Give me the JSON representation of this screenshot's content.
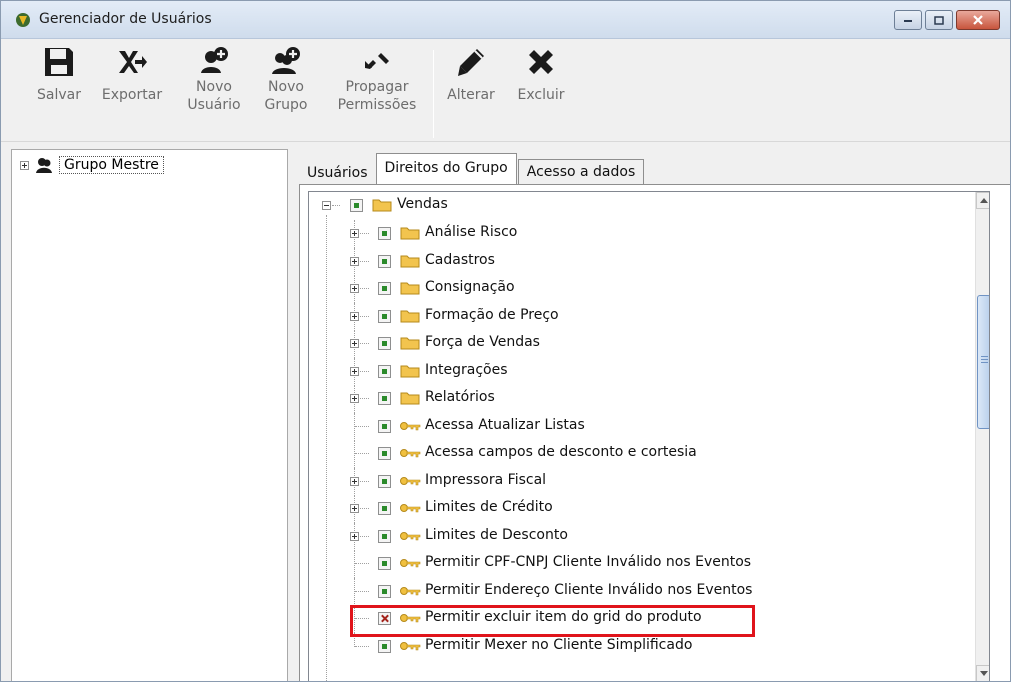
{
  "window": {
    "title": "Gerenciador de Usuários"
  },
  "toolbar": {
    "buttons": [
      {
        "name": "salvar",
        "label": "Salvar",
        "icon": "floppy-disk-icon"
      },
      {
        "name": "exportar",
        "label": "Exportar",
        "icon": "export-icon"
      },
      {
        "name": "novo-usuario",
        "label1": "Novo",
        "label2": "Usuário",
        "icon": "add-user-icon"
      },
      {
        "name": "novo-grupo",
        "label1": "Novo",
        "label2": "Grupo",
        "icon": "add-group-icon"
      },
      {
        "name": "propagar-permissoes",
        "label1": "Propagar",
        "label2": "Permissões",
        "icon": "propagate-icon"
      },
      {
        "name": "alterar",
        "label": "Alterar",
        "icon": "pencil-icon"
      },
      {
        "name": "excluir",
        "label": "Excluir",
        "icon": "delete-x-icon"
      }
    ]
  },
  "left_tree": {
    "root_label": "Grupo Mestre"
  },
  "tabs": [
    {
      "label": "Usuários",
      "active": false
    },
    {
      "label": "Direitos do Grupo",
      "active": true
    },
    {
      "label": "Acesso a dados",
      "active": false
    }
  ],
  "rights_tree": {
    "root": {
      "label": "Vendas",
      "checked": true,
      "expanded": true
    },
    "items": [
      {
        "label": "Análise Risco",
        "type": "folder",
        "checked": true,
        "expandable": true
      },
      {
        "label": "Cadastros",
        "type": "folder",
        "checked": true,
        "expandable": true
      },
      {
        "label": "Consignação",
        "type": "folder",
        "checked": true,
        "expandable": true
      },
      {
        "label": "Formação de Preço",
        "type": "folder",
        "checked": true,
        "expandable": true
      },
      {
        "label": "Força de Vendas",
        "type": "folder",
        "checked": true,
        "expandable": true
      },
      {
        "label": "Integrações",
        "type": "folder",
        "checked": true,
        "expandable": true
      },
      {
        "label": "Relatórios",
        "type": "folder",
        "checked": true,
        "expandable": true
      },
      {
        "label": "Acessa Atualizar Listas",
        "type": "key",
        "checked": true,
        "expandable": false
      },
      {
        "label": "Acessa campos de desconto e cortesia",
        "type": "key",
        "checked": true,
        "expandable": false
      },
      {
        "label": "Impressora Fiscal",
        "type": "key",
        "checked": true,
        "expandable": true
      },
      {
        "label": "Limites de Crédito",
        "type": "key",
        "checked": true,
        "expandable": true
      },
      {
        "label": "Limites de Desconto",
        "type": "key",
        "checked": true,
        "expandable": true
      },
      {
        "label": "Permitir CPF-CNPJ Cliente Inválido nos Eventos",
        "type": "key",
        "checked": true,
        "expandable": false
      },
      {
        "label": "Permitir Endereço Cliente Inválido nos Eventos",
        "type": "key",
        "checked": true,
        "expandable": false
      },
      {
        "label": "Permitir excluir item do grid do produto",
        "type": "key",
        "checked": false,
        "expandable": false,
        "highlighted": true
      },
      {
        "label": "Permitir Mexer no Cliente Simplificado",
        "type": "key",
        "checked": true,
        "expandable": false
      }
    ]
  },
  "colors": {
    "highlight_border": "#e0141b",
    "check_on": "#2a8a2a",
    "check_off": "#a3221a",
    "folder": "#f2c44e"
  }
}
